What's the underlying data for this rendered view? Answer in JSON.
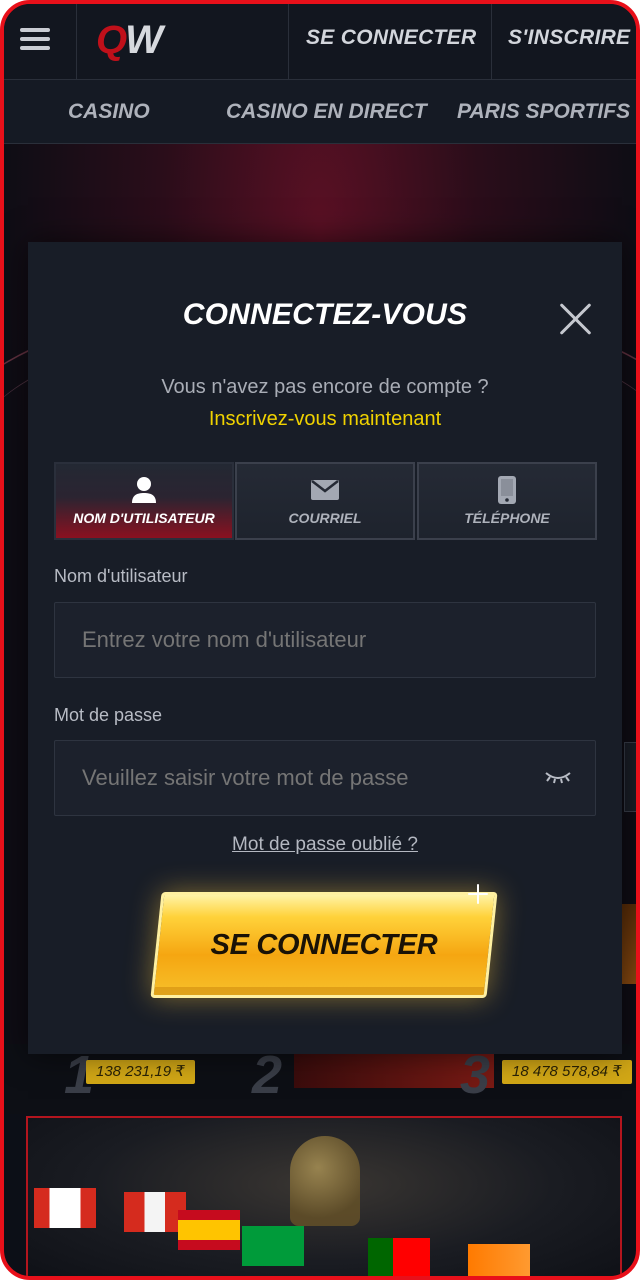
{
  "header": {
    "logo": {
      "part1": "Q",
      "part2": "W"
    },
    "login_link": "SE CONNECTER",
    "register_link": "S'INSCRIRE"
  },
  "nav": {
    "items": [
      {
        "label": "CASINO"
      },
      {
        "label": "CASINO EN DIRECT"
      },
      {
        "label": "PARIS SPORTIFS"
      }
    ]
  },
  "background": {
    "ranks": [
      {
        "number": "1",
        "prize": "138 231,19 ₹"
      },
      {
        "number": "2",
        "prize": ""
      },
      {
        "number": "3",
        "prize": "18 478 578,84 ₹"
      }
    ]
  },
  "modal": {
    "title": "CONNECTEZ-VOUS",
    "no_account_text": "Vous n'avez pas encore de compte ?",
    "register_now": "Inscrivez-vous maintenant",
    "tabs": [
      {
        "label": "NOM D'UTILISATEUR",
        "icon": "user-icon",
        "active": true
      },
      {
        "label": "COURRIEL",
        "icon": "mail-icon",
        "active": false
      },
      {
        "label": "TÉLÉPHONE",
        "icon": "phone-icon",
        "active": false
      }
    ],
    "username": {
      "label": "Nom d'utilisateur",
      "placeholder": "Entrez votre nom d'utilisateur",
      "value": ""
    },
    "password": {
      "label": "Mot de passe",
      "placeholder": "Veuillez saisir votre mot de passe",
      "value": ""
    },
    "forgot_password": "Mot de passe oublié ?",
    "submit_label": "SE CONNECTER"
  },
  "colors": {
    "frame_border": "#e8101a",
    "accent_yellow": "#f0d200",
    "button_gold": "#f5a611",
    "active_tab_red": "#8a1120",
    "modal_bg": "#181d27"
  }
}
